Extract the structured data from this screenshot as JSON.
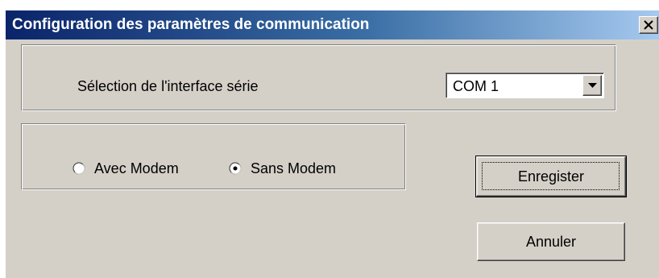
{
  "window": {
    "title": "Configuration des paramètres de communication",
    "close_icon": "close-icon"
  },
  "serial": {
    "label": "Sélection de l'interface série",
    "selected": "COM 1",
    "dropdown_icon": "chevron-down-icon"
  },
  "modem": {
    "options": [
      {
        "label": "Avec Modem",
        "checked": false
      },
      {
        "label": "Sans Modem",
        "checked": true
      }
    ]
  },
  "buttons": {
    "save_label": "Enregister",
    "cancel_label": "Annuler"
  },
  "colors": {
    "dialog_face": "#d4d0c8",
    "title_gradient_start": "#0a246a",
    "title_gradient_end": "#a6caf0",
    "title_text": "#ffffff"
  }
}
